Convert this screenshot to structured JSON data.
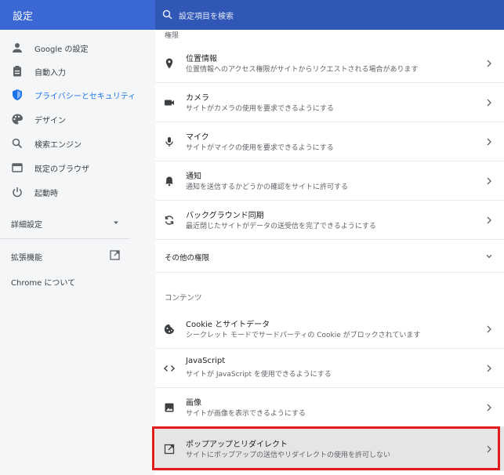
{
  "header": {
    "title": "設定",
    "search_placeholder": "設定項目を検索"
  },
  "sidebar": {
    "items": [
      {
        "label": "Google の設定",
        "icon": "person-icon"
      },
      {
        "label": "自動入力",
        "icon": "clipboard-icon"
      },
      {
        "label": "プライバシーとセキュリティ",
        "icon": "shield-icon",
        "active": true
      },
      {
        "label": "デザイン",
        "icon": "palette-icon"
      },
      {
        "label": "検索エンジン",
        "icon": "search-icon"
      },
      {
        "label": "既定のブラウザ",
        "icon": "browser-icon"
      },
      {
        "label": "起動時",
        "icon": "power-icon"
      }
    ],
    "advanced": "詳細設定",
    "extensions": "拡張機能",
    "about": "Chrome について"
  },
  "main": {
    "section_fragment": "権限",
    "permissions": [
      {
        "title": "位置情報",
        "desc": "位置情報へのアクセス権限がサイトからリクエストされる場合があります",
        "icon": "location-pin-icon"
      },
      {
        "title": "カメラ",
        "desc": "サイトがカメラの使用を要求できるようにする",
        "icon": "camera-icon"
      },
      {
        "title": "マイク",
        "desc": "サイトがマイクの使用を要求できるようにする",
        "icon": "microphone-icon"
      },
      {
        "title": "通知",
        "desc": "通知を送信するかどうかの確認をサイトに許可する",
        "icon": "bell-icon"
      },
      {
        "title": "バックグラウンド同期",
        "desc": "最近閉じたサイトがデータの送受信を完了できるようにする",
        "icon": "sync-icon"
      }
    ],
    "other_permissions": "その他の権限",
    "content_heading": "コンテンツ",
    "content": [
      {
        "title": "Cookie とサイトデータ",
        "desc": "シークレット モードでサードパーティの Cookie がブロックされています",
        "icon": "cookie-icon"
      },
      {
        "title": "JavaScript",
        "desc": "サイトが JavaScript を使用できるようにする",
        "icon": "code-icon"
      },
      {
        "title": "画像",
        "desc": "サイトが画像を表示できるようにする",
        "icon": "image-icon"
      },
      {
        "title": "ポップアップとリダイレクト",
        "desc": "サイトにポップアップの送信やリダイレクトの使用を許可しない",
        "icon": "open-in-new-icon"
      }
    ]
  },
  "colors": {
    "header": "#3b64c9",
    "accent": "#1a73e8",
    "highlight_border": "#e31b1b"
  }
}
